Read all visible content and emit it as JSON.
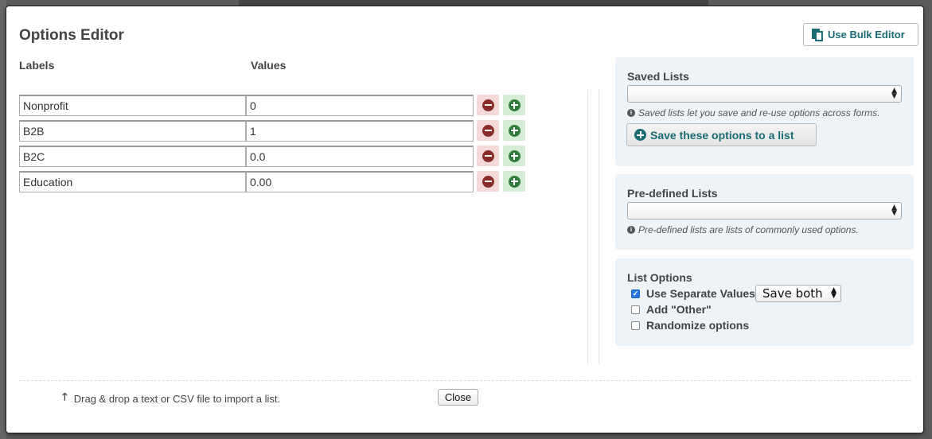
{
  "modal": {
    "title": "Options Editor",
    "bulk_button": "Use Bulk Editor",
    "columns": {
      "labels": "Labels",
      "values": "Values"
    },
    "rows": [
      {
        "label": "Nonprofit",
        "value": "0"
      },
      {
        "label": "B2B",
        "value": "1"
      },
      {
        "label": "B2C",
        "value": "0.0"
      },
      {
        "label": "Education",
        "value": "0.00"
      }
    ]
  },
  "saved_lists": {
    "heading": "Saved Lists",
    "selected": "",
    "hint": "Saved lists let you save and re-use options across forms.",
    "save_button": "Save these options to a list"
  },
  "predefined_lists": {
    "heading": "Pre-defined Lists",
    "selected": "",
    "hint": "Pre-defined lists are lists of commonly used options."
  },
  "list_options": {
    "heading": "List Options",
    "use_separate_values": {
      "label": "Use Separate Values",
      "checked": true,
      "select_value": "Save both"
    },
    "add_other": {
      "label": "Add \"Other\"",
      "checked": false
    },
    "randomize": {
      "label": "Randomize options",
      "checked": false
    }
  },
  "footer": {
    "drag_text": "Drag & drop a text or CSV file to import a list.",
    "close_button": "Close"
  },
  "colors": {
    "accent": "#1a6b75",
    "remove_bg": "#f5d9d9",
    "add_bg": "#d6ecd6",
    "panel_bg": "#eef3f8"
  }
}
